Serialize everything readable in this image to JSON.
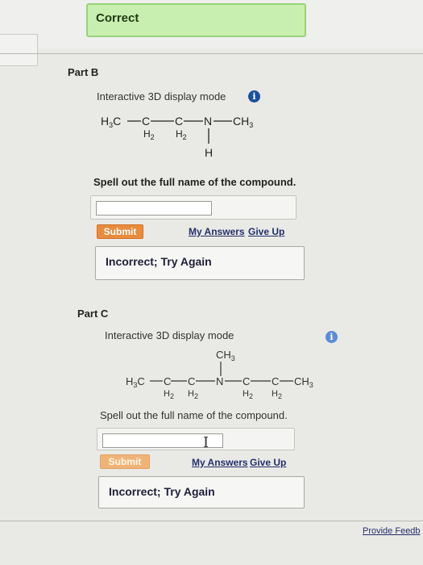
{
  "correct_banner": {
    "text": "Correct"
  },
  "part_b": {
    "label": "Part B",
    "mode_label": "Interactive 3D display mode",
    "info_icon": "i",
    "structure": {
      "left_group": "H3C",
      "ch2a": "C",
      "ch2a_sub": "H2",
      "ch2b": "C",
      "ch2b_sub": "H2",
      "n": "N",
      "n_sub": "H",
      "right_group": "CH3"
    },
    "prompt": "Spell out the full name of the compound.",
    "answer_value": "",
    "submit_label": "Submit",
    "my_answers_label": "My Answers",
    "give_up_label": "Give Up",
    "result_text": "Incorrect; Try Again"
  },
  "part_c": {
    "label": "Part C",
    "mode_label": "Interactive 3D display mode",
    "info_icon": "i",
    "structure": {
      "top_group": "CH3",
      "left_group": "H3C",
      "c1": "C",
      "c1_sub": "H2",
      "c2": "C",
      "c2_sub": "H2",
      "n": "N",
      "c3": "C",
      "c3_sub": "H2",
      "c4": "C",
      "c4_sub": "H2",
      "right_group": "CH3"
    },
    "prompt": "Spell out the full name of the compound.",
    "answer_value": "",
    "submit_label": "Submit",
    "my_answers_label": "My Answers",
    "give_up_label": "Give Up",
    "result_text": "Incorrect; Try Again"
  },
  "footer": {
    "feedback_label": "Provide Feedb"
  }
}
